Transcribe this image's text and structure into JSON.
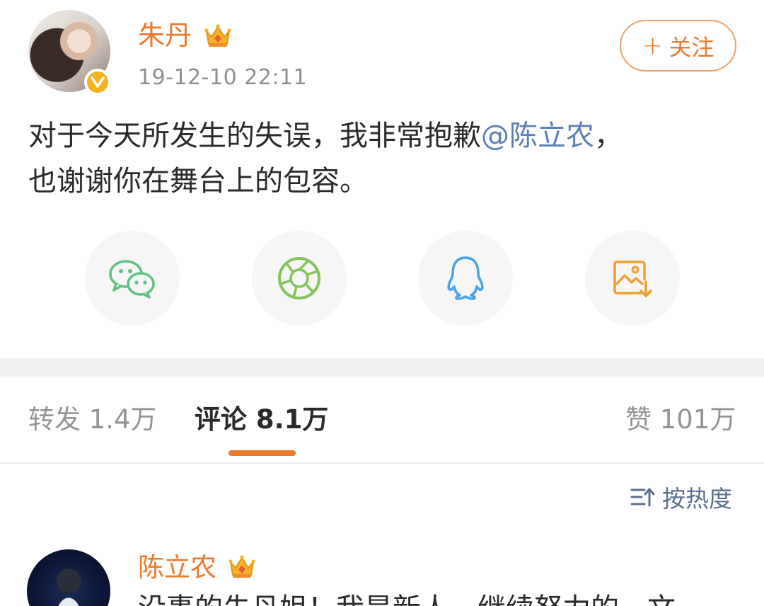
{
  "post": {
    "author": "朱丹",
    "timestamp": "19-12-10 22:11",
    "follow_label": "关注",
    "follow_prefix": "+",
    "text_part1": "对于今天所发生的失误，我非常抱歉",
    "mention": "@陈立农",
    "text_part2": "，",
    "text_line2": "也谢谢你在舞台上的包容。",
    "author_icons": [
      "avatar",
      "verified-badge",
      "crown-icon"
    ]
  },
  "share": {
    "items": [
      {
        "icon": "wechat-icon",
        "color": "#5fc281"
      },
      {
        "icon": "moments-icon",
        "color": "#84c45a"
      },
      {
        "icon": "qq-icon",
        "color": "#4aa3e6"
      },
      {
        "icon": "save-image-icon",
        "color": "#f0a030"
      }
    ]
  },
  "tabs": {
    "repost": "转发 1.4万",
    "comments": "评论 8.1万",
    "likes": "赞 101万",
    "active": "comments"
  },
  "sort": {
    "label": "按热度",
    "icon": "sort-icon"
  },
  "comment": {
    "author": "陈立农",
    "text": "没事的朱丹姐！我是新人，继续努力的，文"
  },
  "colors": {
    "accent": "#ec7a2c",
    "mention": "#5b7fb6",
    "meta": "#8f8f8f",
    "sort": "#5d6f8e"
  }
}
